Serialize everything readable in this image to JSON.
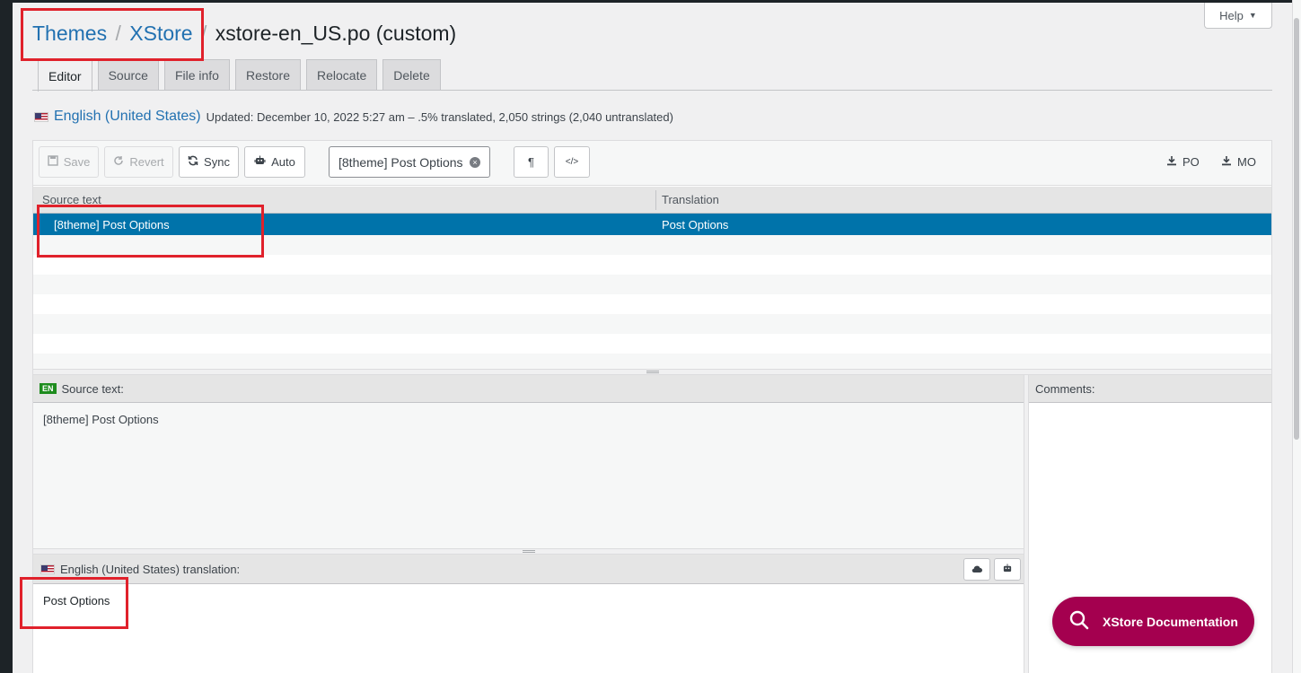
{
  "breadcrumb": {
    "themes": "Themes",
    "xstore": "XStore",
    "separator": "/",
    "file": "xstore-en_US.po (custom)"
  },
  "help": {
    "label": "Help",
    "arrow": "▼"
  },
  "tabs": [
    {
      "label": "Editor",
      "active": true
    },
    {
      "label": "Source"
    },
    {
      "label": "File info"
    },
    {
      "label": "Restore"
    },
    {
      "label": "Relocate"
    },
    {
      "label": "Delete"
    }
  ],
  "locale": {
    "name": "English (United States)",
    "stats": "Updated: December 10, 2022 5:27 am – .5% translated, 2,050 strings (2,040 untranslated)"
  },
  "toolbar": {
    "save": "Save",
    "revert": "Revert",
    "sync": "Sync",
    "auto": "Auto",
    "filter_value": "[8theme] Post Options",
    "pilcrow": "¶",
    "code": "</>",
    "download_po": "PO",
    "download_mo": "MO"
  },
  "grid": {
    "source_header": "Source text",
    "translation_header": "Translation",
    "rows": [
      {
        "source": "[8theme] Post Options",
        "translation": "Post Options"
      }
    ]
  },
  "source_pane": {
    "badge": "EN",
    "label": "Source text:",
    "text": "[8theme] Post Options"
  },
  "translation_pane": {
    "label": "English (United States) translation:",
    "text": "Post Options"
  },
  "comments": {
    "label": "Comments:"
  },
  "doc_button": {
    "label": "XStore Documentation"
  },
  "colors": {
    "selected_row": "#0073aa",
    "link": "#2271b1",
    "doc_button": "#a4004f",
    "highlight_box": "#e0212b"
  }
}
